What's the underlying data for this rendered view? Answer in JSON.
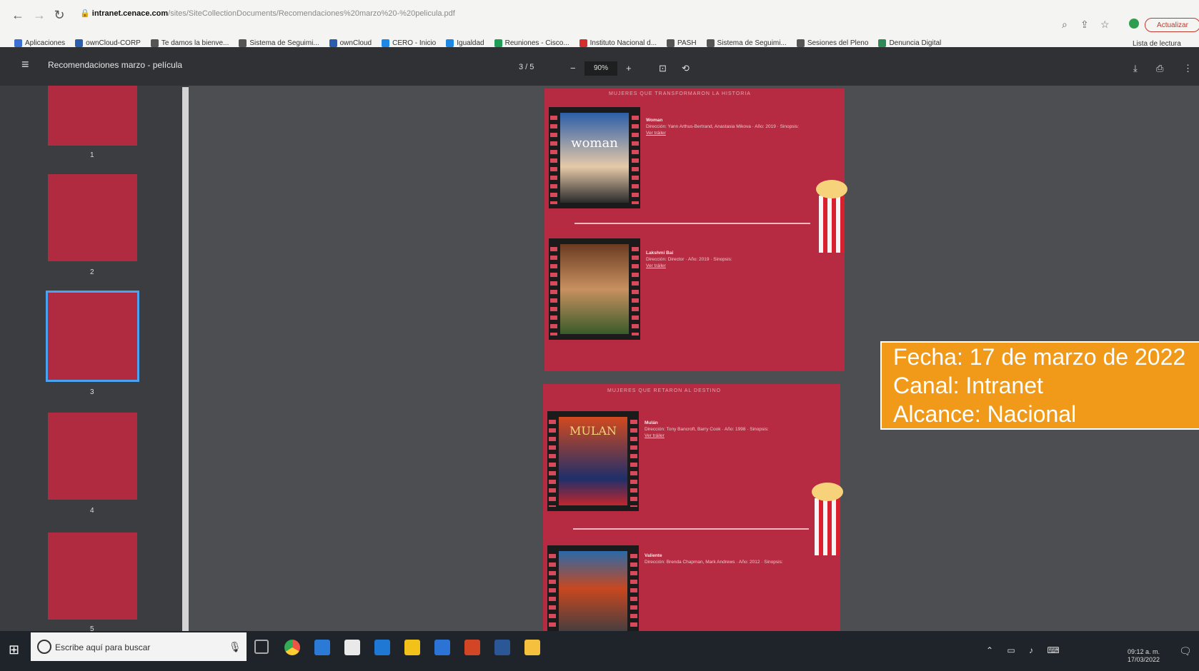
{
  "browser": {
    "url_host": "intranet.cenace.com",
    "url_path": "/sites/SiteCollectionDocuments/Recomendaciones%20marzo%20-%20pelicula.pdf",
    "update_label": "Actualizar",
    "reading_list": "Lista de lectura",
    "bookmarks": [
      "Aplicaciones",
      "ownCloud-CORP",
      "Te damos la bienve...",
      "Sistema de Seguimi...",
      "ownCloud",
      "CERO - Inicio",
      "Igualdad",
      "Reuniones - Cisco...",
      "Instituto Nacional d...",
      "PASH",
      "Sistema de Seguimi...",
      "Sesiones del Pleno",
      "Denuncia Digital"
    ]
  },
  "viewer": {
    "doc_title": "Recomendaciones marzo - película",
    "page_indicator": "3  /  5",
    "zoom": "90%",
    "thumbs": [
      "1",
      "2",
      "3",
      "4",
      "5"
    ]
  },
  "page_a": {
    "header": "MUJERES QUE TRANSFORMARON LA HISTORIA",
    "m1_title": "Woman",
    "m1_body": "Dirección: Yann Arthus-Bertrand, Anastasia Mikova · Año: 2019 · Sinopsis:",
    "m1_link": "Ver tráiler",
    "m1_poster": "woman",
    "m2_title": "Lakshmi Bai",
    "m2_body": "Dirección: Director · Año: 2019 · Sinopsis:",
    "m2_link": "Ver tráiler"
  },
  "page_b": {
    "header": "MUJERES QUE RETARON AL DESTINO",
    "m1_title": "Mulán",
    "m1_body": "Dirección: Tony Bancroft, Barry Cook · Año: 1998 · Sinopsis:",
    "m1_link": "Ver tráiler",
    "m1_poster": "MULAN",
    "m2_title": "Valiente",
    "m2_body": "Dirección: Brenda Chapman, Mark Andrews · Año: 2012 · Sinopsis:"
  },
  "info": {
    "fecha": "Fecha: 17 de marzo de 2022",
    "canal": "Canal: Intranet",
    "alcance": "Alcance: Nacional"
  },
  "taskbar": {
    "search_placeholder": "Escribe aquí para buscar",
    "time": "09:12 a. m.",
    "date": "17/03/2022"
  }
}
